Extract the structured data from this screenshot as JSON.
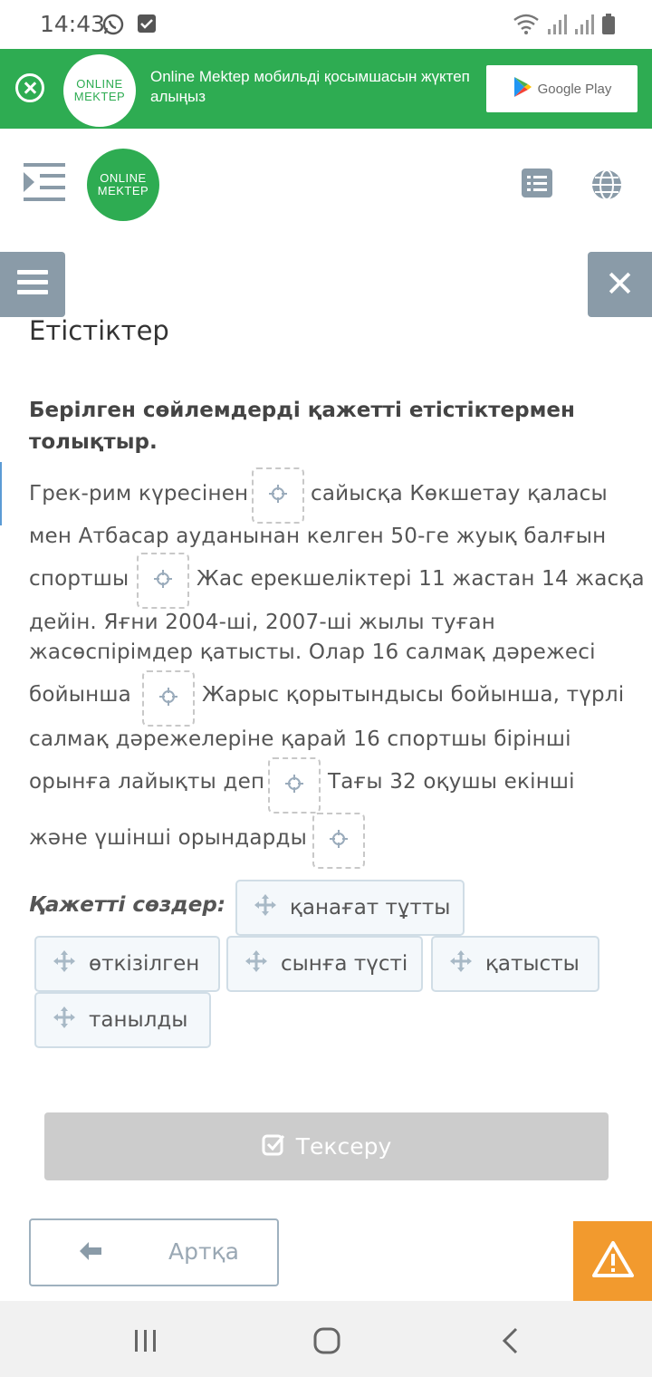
{
  "status_bar": {
    "time": "14:43"
  },
  "banner": {
    "logo_top": "ONLINE",
    "logo_bottom": "MEKTEP",
    "text": "Online Mektep мобильді қосымшасын жүктеп алыңыз",
    "store_label": "Google Play"
  },
  "header": {
    "logo_top": "ONLINE",
    "logo_bottom": "MEKTEP"
  },
  "page": {
    "title": "Етістіктер",
    "instruction": "Берілген сөйлемдерді қажетті етістіктермен толықтыр."
  },
  "exercise": {
    "lines": [
      "Грек-рим күресінен",
      "сайысқа Көкшетау қаласы",
      "мен Атбасар ауданынан келген 50-ге жуық балғын",
      "спортшы",
      "Жас ерекшеліктері 11 жастан 14 жасқа",
      "дейін. Яғни 2004-ші, 2007-ші жылы туған",
      "жасөспірімдер қатысты. Олар 16 салмақ дәрежесі",
      "бойынша",
      "Жарыс қорытындысы бойынша, түрлі",
      "салмақ дәрежелеріне қарай 16 спортшы бірінші",
      "орынға лайықты деп",
      "Тағы 32 оқушы екінші",
      "және үшінші орындарды"
    ]
  },
  "words": {
    "label": "Қажетті сөздер:",
    "items": [
      "қанағат тұтты",
      "өткізілген",
      "сынға түсті",
      "қатысты",
      "танылды"
    ]
  },
  "buttons": {
    "check": "Тексеру",
    "back": "Артқа"
  },
  "colors": {
    "brand_green": "#2eac52",
    "side_button": "#8a9ba8",
    "warning": "#f29a2e"
  }
}
